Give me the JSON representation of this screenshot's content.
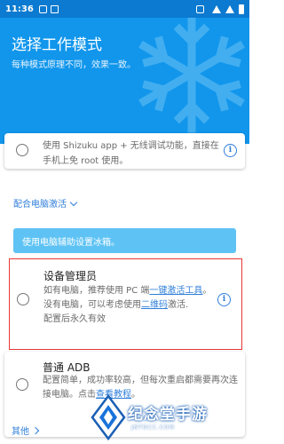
{
  "status_bar": {
    "time": "11:36"
  },
  "header": {
    "title": "选择工作模式",
    "subtitle": "每种模式原理不同，效果一致。"
  },
  "cards": {
    "shizuku": {
      "description": "使用 Shizuku app + 无线调试功能，直接在手机上免 root 使用。"
    },
    "pc_section": {
      "label": "配合电脑激活"
    },
    "banner": "使用电脑辅助设置冰箱。",
    "device_admin": {
      "title": "设备管理员",
      "line1_prefix": "如有电脑，推荐使用 PC 端",
      "line1_link": "一键激活工具",
      "line1_suffix": "。",
      "line2_prefix": "没有电脑，可以考虑使用",
      "line2_link": "二维码",
      "line2_suffix": "激活.",
      "line3": "配置后永久有效"
    },
    "adb": {
      "title": "普通 ADB",
      "desc_prefix": "配置简单，成功率较高，但每次重启都需要再次连接电脑。点击",
      "desc_link": "查看教程",
      "desc_suffix": "。"
    }
  },
  "other_link": "其他",
  "watermark": {
    "text": "纪念堂手游",
    "sub": "JNTDCC.COM"
  },
  "colors": {
    "primary": "#1196ec",
    "accent": "#2f7fd9",
    "banner": "#5ec3f4",
    "highlight": "#e53935"
  }
}
